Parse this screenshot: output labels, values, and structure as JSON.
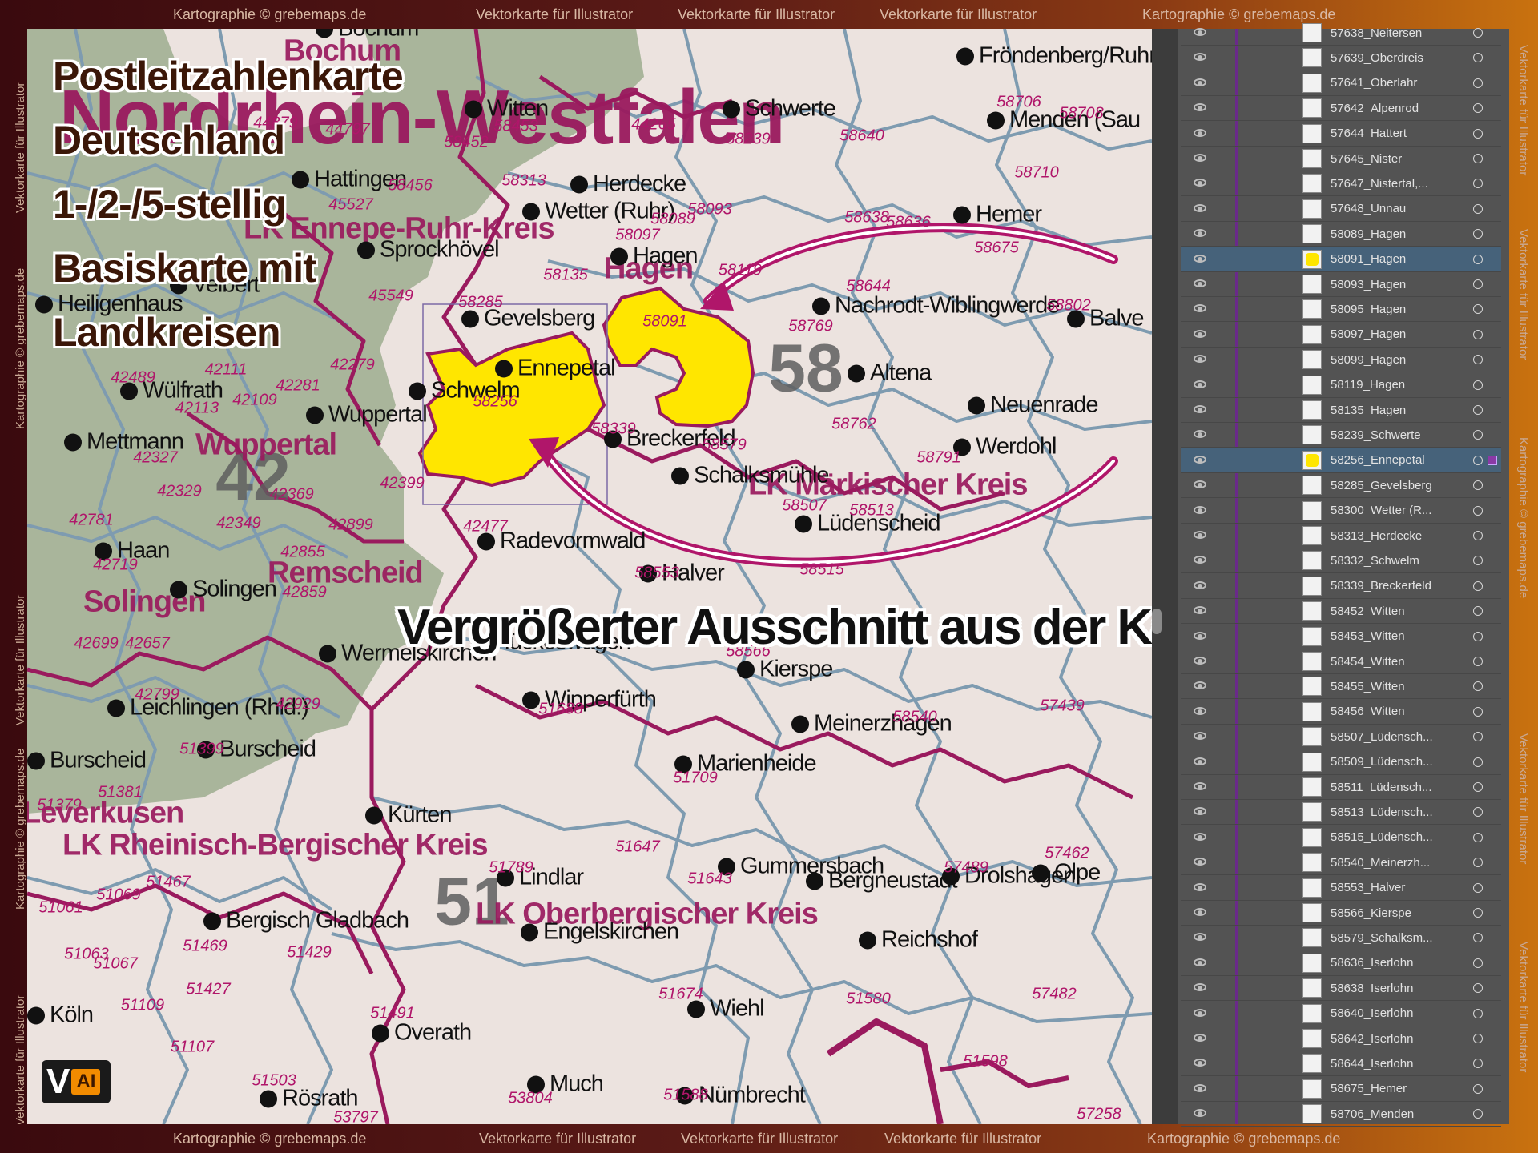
{
  "frame": {
    "top": [
      "Kartographie © grebemaps.de",
      "Vektorkarte für Illustrator",
      "Vektorkarte für Illustrator",
      "Vektorkarte für Illustrator",
      "Kartographie © grebemaps.de"
    ],
    "bottom": [
      "Kartographie © grebemaps.de",
      "Vektorkarte für Illustrator",
      "Vektorkarte für Illustrator",
      "Vektorkarte für Illustrator",
      "Kartographie © grebemaps.de"
    ],
    "left": [
      "Vektorkarte für Illustrator",
      "Kartographie © grebemaps.de",
      "Vektorkarte für Illustrator",
      "Kartographie © grebemaps.de",
      "Vektorkarte für Illustrator"
    ],
    "right": [
      "Vektorkarte für Illustrator",
      "Vektorkarte für Illustrator",
      "Kartographie © grebemaps.de",
      "Vektorkarte für Illustrator",
      "Vektorkarte für Illustrator"
    ]
  },
  "title": {
    "lines": [
      "Postleitzahlenkarte",
      "Deutschland",
      "1-/2-/5-stellig",
      "Basiskarte mit",
      "Landkreisen"
    ],
    "state_label": "Nordrhein-Westfalen"
  },
  "callout": "Vergrößerter Ausschnitt aus der Karte!",
  "badge": {
    "v": "V",
    "ai": "AI"
  },
  "colors": {
    "map_bg": "#ece3df",
    "green_area": "#a9b59b",
    "highlight": "#ffe600",
    "border_magenta": "#9a1a5e",
    "border_blue": "#7e9bb0",
    "arrow": "#b0166a"
  },
  "zones": [
    "42",
    "58",
    "51"
  ],
  "regions": [
    "LK Ennepe-Ruhr-Kreis",
    "Hagen",
    "Wuppertal",
    "Remscheid",
    "Solingen",
    "LK Märkischer Kreis",
    "LK Rheinisch-Bergischer Kreis",
    "LK Oberbergischer Kreis",
    "Leverkusen",
    "Bochum"
  ],
  "places": [
    "Bochum",
    "Witten",
    "Schwerte",
    "Fröndenberg/Ruhr",
    "Menden (Sau",
    "Hattingen",
    "Herdecke",
    "Wetter (Ruhr)",
    "Hemer",
    "Sprockhövel",
    "Hagen",
    "Gevelsberg",
    "Nachrodt-Wiblingwerde",
    "Balve",
    "Ennepetal",
    "Schwelm",
    "Altena",
    "Neuenrade",
    "Wülfrath",
    "Wuppertal",
    "Breckerfeld",
    "Werdohl",
    "Mettmann",
    "Schalksmühle",
    "Lüdenscheid",
    "Haan",
    "Radevormwald",
    "Halver",
    "Solingen",
    "Hückeswagen",
    "Wermelskirchen",
    "Kierspe",
    "Wipperfürth",
    "Burscheid",
    "Meinerzhagen",
    "Marienheide",
    "Kürten",
    "Lindlar",
    "Gummersbach",
    "Bergneustadt",
    "Drolshagen",
    "Olpe",
    "Bergisch Gladbach",
    "Engelskirchen",
    "Reichshof",
    "Köln",
    "Wiehl",
    "Overath",
    "Rösrath",
    "Much",
    "Nümbrecht",
    "Heiligenhaus",
    "Velbert",
    "Burscheid",
    "Leichlingen (Rhld.)"
  ],
  "postcodes": [
    "44797",
    "44879",
    "44265",
    "58452",
    "58453",
    "58239",
    "58640",
    "58706",
    "58708",
    "45527",
    "58456",
    "58313",
    "58093",
    "58710",
    "58638",
    "58636",
    "58675",
    "58097",
    "58089",
    "58135",
    "58119",
    "58644",
    "58802",
    "45549",
    "58285",
    "58091",
    "58769",
    "42111",
    "42279",
    "42109",
    "42281",
    "42113",
    "58256",
    "58339",
    "58762",
    "42327",
    "42369",
    "58579",
    "58791",
    "42399",
    "42329",
    "42349",
    "58507",
    "58513",
    "42781",
    "42899",
    "42477",
    "58553",
    "58515",
    "42719",
    "42855",
    "42859",
    "42699",
    "42657",
    "58566",
    "42799",
    "42929",
    "51688",
    "57439",
    "58540",
    "51399",
    "51709",
    "51381",
    "51379",
    "51647",
    "51789",
    "51643",
    "57462",
    "57489",
    "51467",
    "51069",
    "51061",
    "51469",
    "51429",
    "51063",
    "51067",
    "51427",
    "51674",
    "51580",
    "57482",
    "51109",
    "51491",
    "51107",
    "51503",
    "53797",
    "53804",
    "51588",
    "51598",
    "57258",
    "42489"
  ],
  "layers_panel": {
    "layers": [
      {
        "name": "57638_Neitersen",
        "selected": false,
        "yellow": false
      },
      {
        "name": "57639_Oberdreis",
        "selected": false,
        "yellow": false
      },
      {
        "name": "57641_Oberlahr",
        "selected": false,
        "yellow": false
      },
      {
        "name": "57642_Alpenrod",
        "selected": false,
        "yellow": false
      },
      {
        "name": "57644_Hattert",
        "selected": false,
        "yellow": false
      },
      {
        "name": "57645_Nister",
        "selected": false,
        "yellow": false
      },
      {
        "name": "57647_Nistertal,...",
        "selected": false,
        "yellow": false
      },
      {
        "name": "57648_Unnau",
        "selected": false,
        "yellow": false
      },
      {
        "name": "58089_Hagen",
        "selected": false,
        "yellow": false
      },
      {
        "name": "58091_Hagen",
        "selected": true,
        "yellow": true
      },
      {
        "name": "58093_Hagen",
        "selected": false,
        "yellow": false
      },
      {
        "name": "58095_Hagen",
        "selected": false,
        "yellow": false
      },
      {
        "name": "58097_Hagen",
        "selected": false,
        "yellow": false
      },
      {
        "name": "58099_Hagen",
        "selected": false,
        "yellow": false
      },
      {
        "name": "58119_Hagen",
        "selected": false,
        "yellow": false
      },
      {
        "name": "58135_Hagen",
        "selected": false,
        "yellow": false
      },
      {
        "name": "58239_Schwerte",
        "selected": false,
        "yellow": false
      },
      {
        "name": "58256_Ennepetal",
        "selected": true,
        "yellow": true
      },
      {
        "name": "58285_Gevelsberg",
        "selected": false,
        "yellow": false
      },
      {
        "name": "58300_Wetter (R...",
        "selected": false,
        "yellow": false
      },
      {
        "name": "58313_Herdecke",
        "selected": false,
        "yellow": false
      },
      {
        "name": "58332_Schwelm",
        "selected": false,
        "yellow": false
      },
      {
        "name": "58339_Breckerfeld",
        "selected": false,
        "yellow": false
      },
      {
        "name": "58452_Witten",
        "selected": false,
        "yellow": false
      },
      {
        "name": "58453_Witten",
        "selected": false,
        "yellow": false
      },
      {
        "name": "58454_Witten",
        "selected": false,
        "yellow": false
      },
      {
        "name": "58455_Witten",
        "selected": false,
        "yellow": false
      },
      {
        "name": "58456_Witten",
        "selected": false,
        "yellow": false
      },
      {
        "name": "58507_Lüdensch...",
        "selected": false,
        "yellow": false
      },
      {
        "name": "58509_Lüdensch...",
        "selected": false,
        "yellow": false
      },
      {
        "name": "58511_Lüdensch...",
        "selected": false,
        "yellow": false
      },
      {
        "name": "58513_Lüdensch...",
        "selected": false,
        "yellow": false
      },
      {
        "name": "58515_Lüdensch...",
        "selected": false,
        "yellow": false
      },
      {
        "name": "58540_Meinerzh...",
        "selected": false,
        "yellow": false
      },
      {
        "name": "58553_Halver",
        "selected": false,
        "yellow": false
      },
      {
        "name": "58566_Kierspe",
        "selected": false,
        "yellow": false
      },
      {
        "name": "58579_Schalksm...",
        "selected": false,
        "yellow": false
      },
      {
        "name": "58636_Iserlohn",
        "selected": false,
        "yellow": false
      },
      {
        "name": "58638_Iserlohn",
        "selected": false,
        "yellow": false
      },
      {
        "name": "58640_Iserlohn",
        "selected": false,
        "yellow": false
      },
      {
        "name": "58642_Iserlohn",
        "selected": false,
        "yellow": false
      },
      {
        "name": "58644_Iserlohn",
        "selected": false,
        "yellow": false
      },
      {
        "name": "58675_Hemer",
        "selected": false,
        "yellow": false
      },
      {
        "name": "58706_Menden",
        "selected": false,
        "yellow": false
      }
    ]
  }
}
